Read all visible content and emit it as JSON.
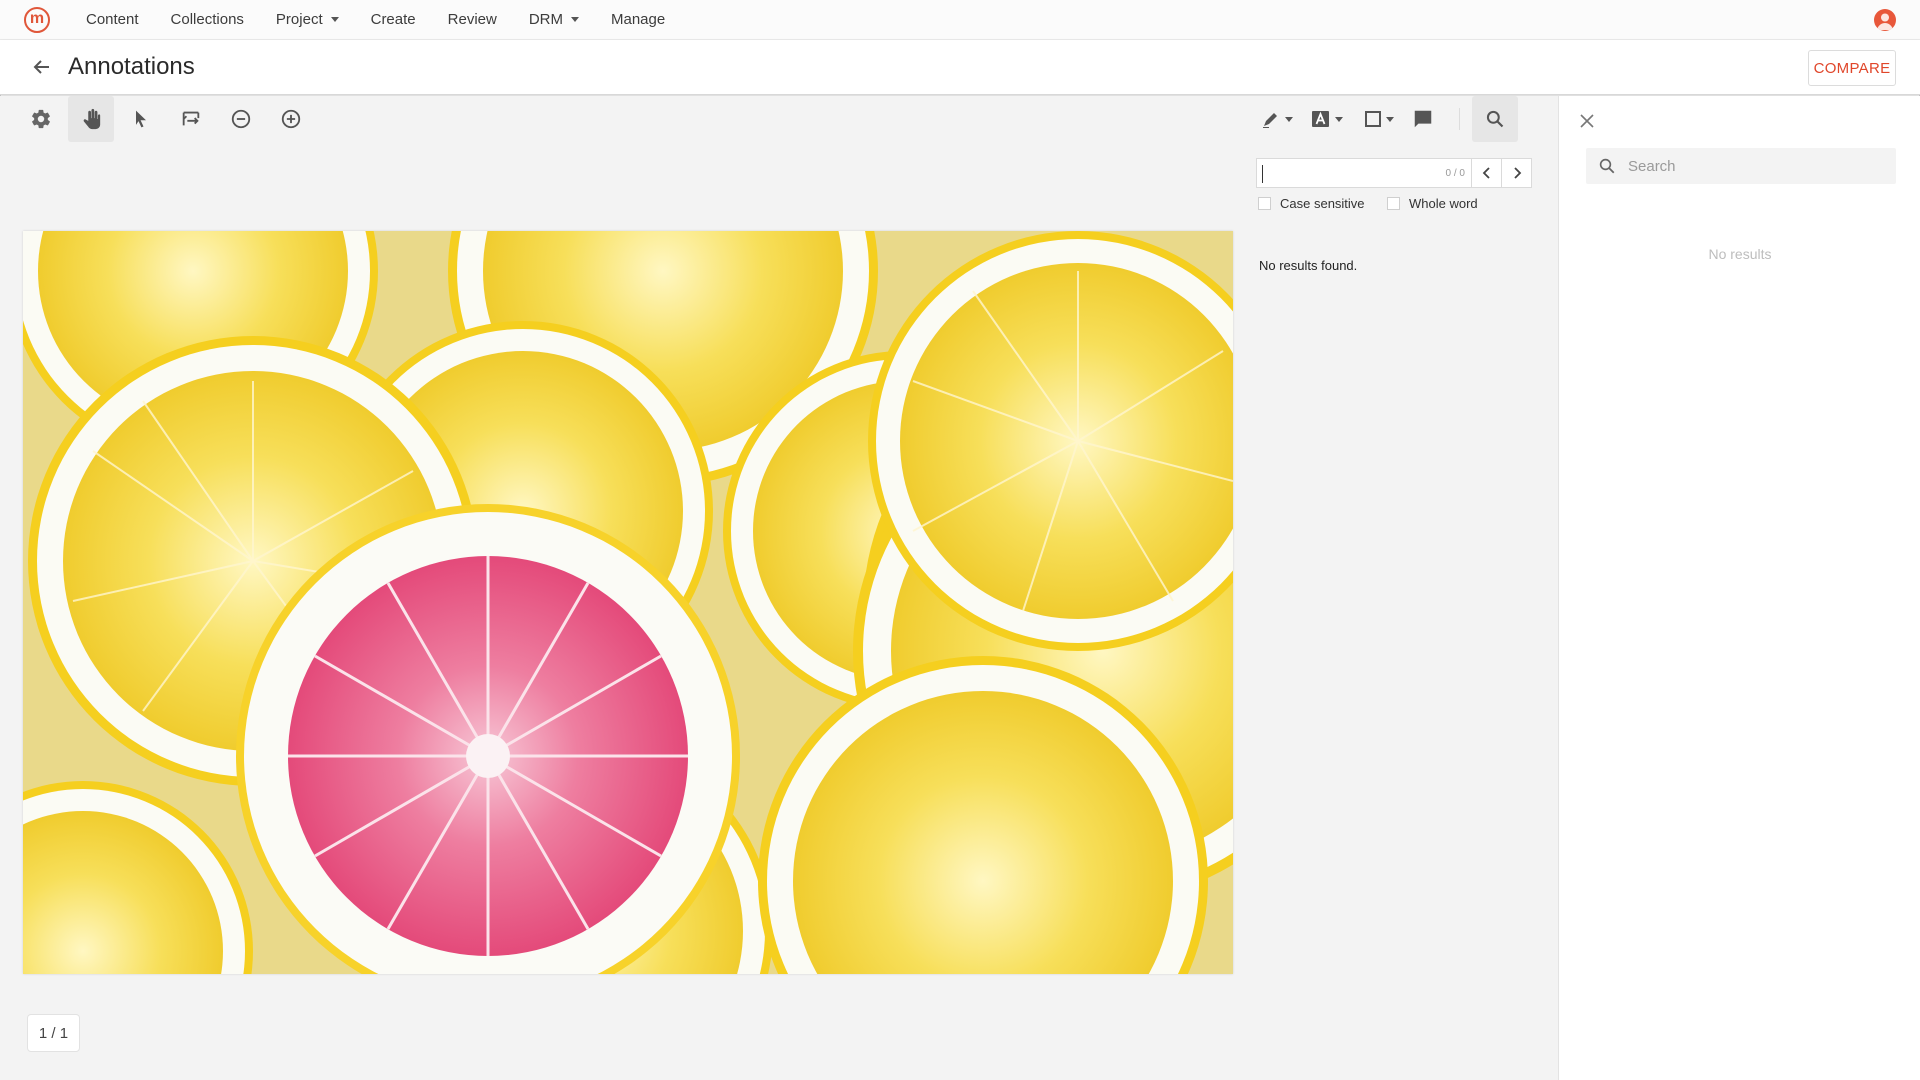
{
  "nav": {
    "items": [
      {
        "label": "Content",
        "dropdown": false
      },
      {
        "label": "Collections",
        "dropdown": false
      },
      {
        "label": "Project",
        "dropdown": true
      },
      {
        "label": "Create",
        "dropdown": false
      },
      {
        "label": "Review",
        "dropdown": false
      },
      {
        "label": "DRM",
        "dropdown": true
      },
      {
        "label": "Manage",
        "dropdown": false
      }
    ],
    "logo_letter": "m"
  },
  "header": {
    "title": "Annotations",
    "compare_label": "COMPARE"
  },
  "toolbar": {
    "left_tools": [
      "gear-icon",
      "hand-pan-icon",
      "pointer-select-icon",
      "marquee-zoom-icon",
      "zoom-out-icon",
      "zoom-in-icon"
    ],
    "active_tool": "hand-pan-icon",
    "right_tools": [
      "pen-dropdown-icon",
      "text-dropdown-icon",
      "shape-dropdown-icon",
      "comment-icon",
      "search-icon"
    ]
  },
  "doc_search": {
    "value": "",
    "count": "0 / 0",
    "case_sensitive_label": "Case sensitive",
    "whole_word_label": "Whole word",
    "result_text": "No results found."
  },
  "page_indicator": "1 / 1",
  "sidebar": {
    "search_placeholder": "Search",
    "empty_text": "No results"
  },
  "colors": {
    "accent": "#e0462a",
    "lemon_yellow": "#f6d93a",
    "pink_citrus": "#e8567f"
  }
}
